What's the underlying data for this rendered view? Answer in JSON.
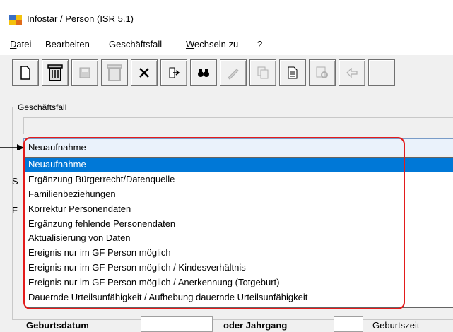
{
  "window": {
    "title": "Infostar / Person (ISR 5.1)"
  },
  "menu": [
    {
      "label_pre": "",
      "label_u": "D",
      "label_post": "atei"
    },
    {
      "label_pre": "",
      "label_u": "",
      "label_post": "Bearbeiten"
    },
    {
      "label_pre": "",
      "label_u": "",
      "label_post": "Geschäftsfall"
    },
    {
      "label_pre": "",
      "label_u": "W",
      "label_post": "echseln zu"
    },
    {
      "label_pre": "",
      "label_u": "",
      "label_post": "?"
    }
  ],
  "toolbar": {
    "buttons": [
      {
        "name": "new-document-icon",
        "glyph": "🗋",
        "enabled": true
      },
      {
        "name": "trash-icon",
        "glyph": "🗑",
        "enabled": true
      },
      {
        "name": "save-icon",
        "glyph": "💾",
        "enabled": false
      },
      {
        "name": "trash-disabled-icon",
        "glyph": "🗑",
        "enabled": false
      },
      {
        "name": "close-x-icon",
        "glyph": "✕",
        "enabled": true
      },
      {
        "name": "import-icon",
        "glyph": "⇲",
        "enabled": true
      },
      {
        "name": "binoculars-icon",
        "glyph": "🔭",
        "enabled": true
      },
      {
        "name": "sign-icon",
        "glyph": "✍",
        "enabled": false
      },
      {
        "name": "copy-icon",
        "glyph": "⧉",
        "enabled": false
      },
      {
        "name": "document-icon",
        "glyph": "🗎",
        "enabled": true
      },
      {
        "name": "preview-icon",
        "glyph": "🔍",
        "enabled": false
      },
      {
        "name": "back-arrow-icon",
        "glyph": "⇦",
        "enabled": false
      }
    ]
  },
  "geschaeftsfall": {
    "group_label": "Geschäftsfall",
    "selected": "Neuaufnahme",
    "options": [
      "Neuaufnahme",
      "Ergänzung Bürgerrecht/Datenquelle",
      "Familienbeziehungen",
      "Korrektur Personendaten",
      "Ergänzung fehlende Personendaten",
      "Aktualisierung von Daten",
      "Ereignis nur im GF Person möglich",
      "Ereignis nur im GF Person möglich / Kindesverhältnis",
      "Ereignis nur im GF Person möglich / Anerkennung (Totgeburt)",
      "Dauernde Urteilsunfähigkeit / Aufhebung dauernde Urteilsunfähigkeit"
    ],
    "highlighted_index": 0
  },
  "side_labels": {
    "s": "S",
    "f": "F"
  },
  "bottom": {
    "geburtsdatum_label": "Geburtsdatum",
    "oder_jahrgang_label": "oder Jahrgang",
    "geburtszeit_label": "Geburtszeit"
  },
  "colors": {
    "selection": "#0078d7",
    "annotation": "#e31b1b"
  }
}
